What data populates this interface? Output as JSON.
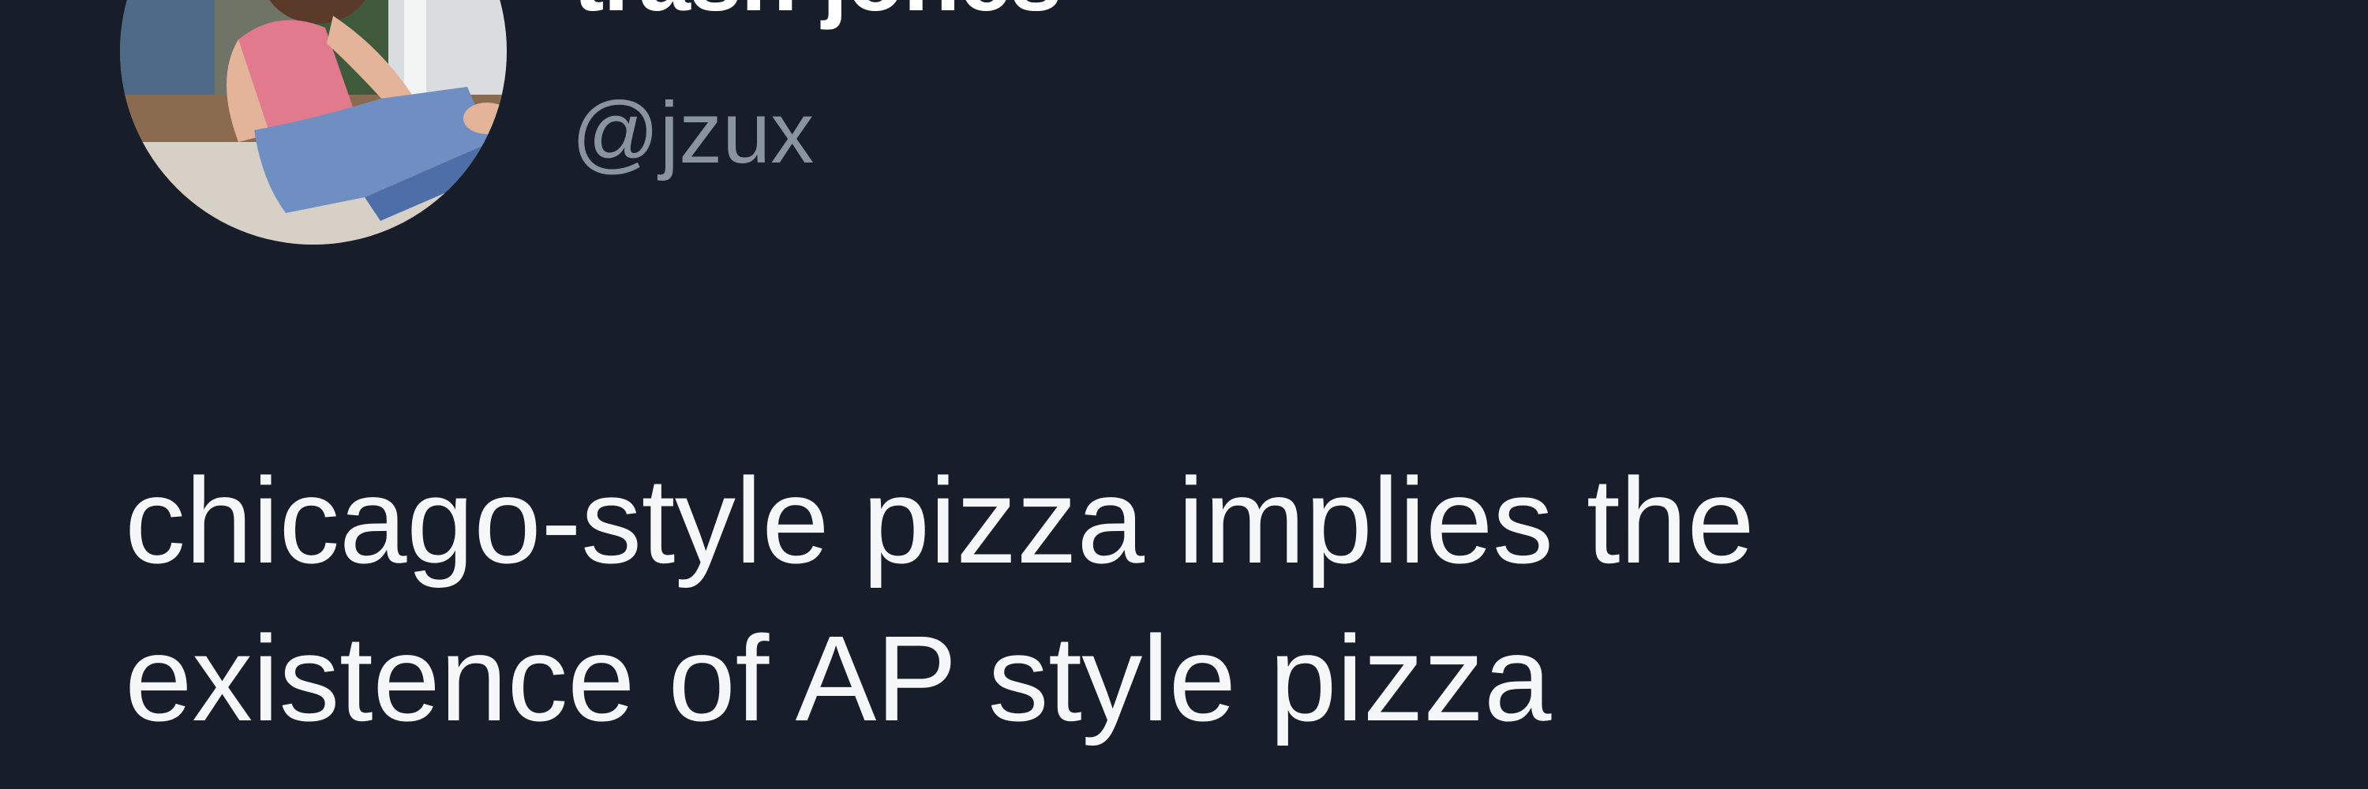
{
  "author": {
    "display_name": "trash jones",
    "handle": "@jzux"
  },
  "tweet": {
    "lines": [
      "chicago-style pizza implies the",
      "existence of AP style pizza"
    ]
  },
  "theme": {
    "background": "#171d29",
    "text": "#f5f7f9",
    "muted": "#8a949e"
  }
}
